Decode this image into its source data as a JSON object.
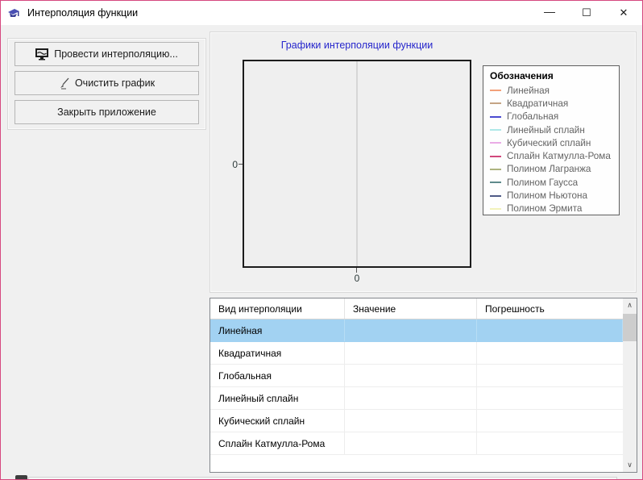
{
  "window": {
    "title": "Интерполяция функции",
    "minimize_label": "—",
    "maximize_label": "☐",
    "close_label": "✕"
  },
  "left_panel": {
    "run_button": "Провести интерполяцию...",
    "clear_button": "Очистить график",
    "close_button": "Закрыть приложение"
  },
  "chart": {
    "title": "Графики интерполяции функции",
    "x_tick_label": "0",
    "y_tick_label": "0",
    "legend": {
      "title": "Обозначения",
      "items": [
        {
          "label": "Линейная",
          "color": "#f2a07a"
        },
        {
          "label": "Квадратичная",
          "color": "#c4a484"
        },
        {
          "label": "Глобальная",
          "color": "#4b4bd0"
        },
        {
          "label": "Линейный сплайн",
          "color": "#aee8e8"
        },
        {
          "label": "Кубический сплайн",
          "color": "#eaace6"
        },
        {
          "label": "Сплайн Катмулла-Рома",
          "color": "#d1477c"
        },
        {
          "label": "Полином Лагранжа",
          "color": "#adb37f"
        },
        {
          "label": "Полином Гаусса",
          "color": "#5f8a8b"
        },
        {
          "label": "Полином Ньютона",
          "color": "#4f5a86"
        },
        {
          "label": "Полином Эрмита",
          "color": "#f2f2bb"
        }
      ]
    }
  },
  "table": {
    "columns": [
      "Вид интерполяции",
      "Значение",
      "Погрешность"
    ],
    "rows": [
      {
        "name": "Линейная",
        "value": "",
        "error": "",
        "selected": true
      },
      {
        "name": "Квадратичная",
        "value": "",
        "error": "",
        "selected": false
      },
      {
        "name": "Глобальная",
        "value": "",
        "error": "",
        "selected": false
      },
      {
        "name": "Линейный сплайн",
        "value": "",
        "error": "",
        "selected": false
      },
      {
        "name": "Кубический сплайн",
        "value": "",
        "error": "",
        "selected": false
      },
      {
        "name": "Сплайн Катмулла-Рома",
        "value": "",
        "error": "",
        "selected": false
      }
    ]
  },
  "colors": {
    "window_border": "#d6487f",
    "selection_blue": "#a2d2f2",
    "chart_title_blue": "#2626cc"
  }
}
